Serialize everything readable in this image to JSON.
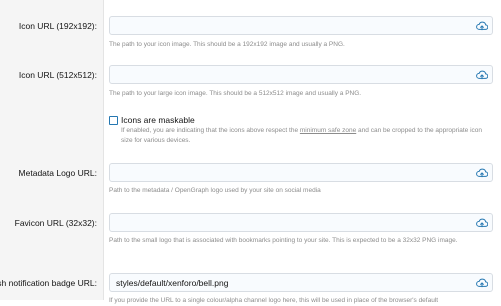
{
  "fields": [
    {
      "label": "Icon URL (192x192):",
      "value": "",
      "hint": "The path to your icon image. This should be a 192x192 image and usually a PNG."
    },
    {
      "label": "Icon URL (512x512):",
      "value": "",
      "hint": "The path to your large icon image. This should be a 512x512 image and usually a PNG."
    },
    {
      "label": "Metadata Logo URL:",
      "value": "",
      "hint": "Path to the metadata / OpenGraph logo used by your site on social media"
    },
    {
      "label": "Favicon URL (32x32):",
      "value": "",
      "hint": "Path to the small logo that is associated with bookmarks pointing to your site. This is expected to be a 32x32 PNG image."
    },
    {
      "label": "sh notification badge URL:",
      "value": "styles/default/xenforo/bell.png",
      "hint": "If you provide the URL to a single colour/alpha channel logo here, this will be used in place of the browser's default"
    }
  ],
  "maskable": {
    "label": "Icons are maskable",
    "hint_before": "If enabled, you are indicating that the icons above respect the",
    "hint_link": "minimum safe zone",
    "hint_after": "and can be cropped to the appropriate icon size for various devices."
  },
  "colors": {
    "accent": "#2577b1",
    "hint": "#8c8c8c",
    "label_bg": "#f5f5f5"
  },
  "icons": {
    "upload": "upload-cloud-icon"
  }
}
